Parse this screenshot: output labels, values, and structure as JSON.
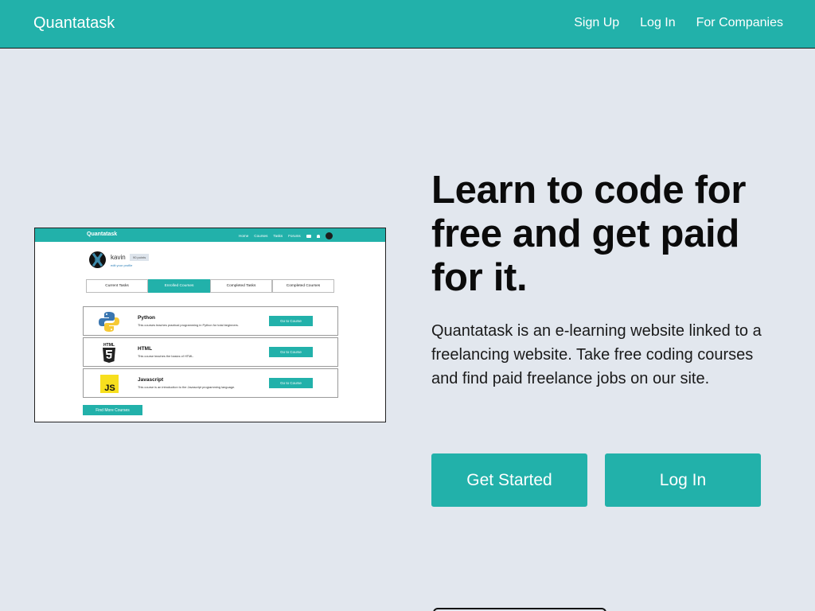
{
  "header": {
    "brand": "Quantatask",
    "nav": [
      "Sign Up",
      "Log In",
      "For Companies"
    ]
  },
  "preview": {
    "brand": "Quantatask",
    "nav": [
      "Home",
      "Courses",
      "Tasks",
      "Forums"
    ],
    "profile": {
      "name": "kavin",
      "points": "90 points",
      "edit_link": "edit your profile"
    },
    "tabs": [
      "Current Tasks",
      "Enrolled Courses",
      "Completed Tasks",
      "Completed Courses"
    ],
    "active_tab": "Enrolled Courses",
    "courses": [
      {
        "name": "Python",
        "desc": "This courses teaches practical programming in Python for total beginners.",
        "button": "Go to Course",
        "icon": "python-logo-icon"
      },
      {
        "name": "HTML",
        "desc": "This course teaches the basics of HTML.",
        "button": "Go to Course",
        "icon": "html5-logo-icon",
        "icon_label": "HTML"
      },
      {
        "name": "Javascript",
        "desc": "This course is an introduction to the Javascript programming language.",
        "button": "Go to Course",
        "icon": "js-logo-icon",
        "icon_label": "JS"
      }
    ],
    "find_more": "Find More Courses"
  },
  "hero": {
    "headline": "Learn to code for free and get paid for it.",
    "description": "Quantatask is an e-learning website linked to a freelancing website. Take free coding courses and find paid freelance jobs on our site."
  },
  "buttons": {
    "get_started": "Get Started",
    "log_in": "Log In"
  },
  "colors": {
    "accent": "#22b1aa",
    "background": "#e2e7ee",
    "text": "#0b0b0b"
  }
}
